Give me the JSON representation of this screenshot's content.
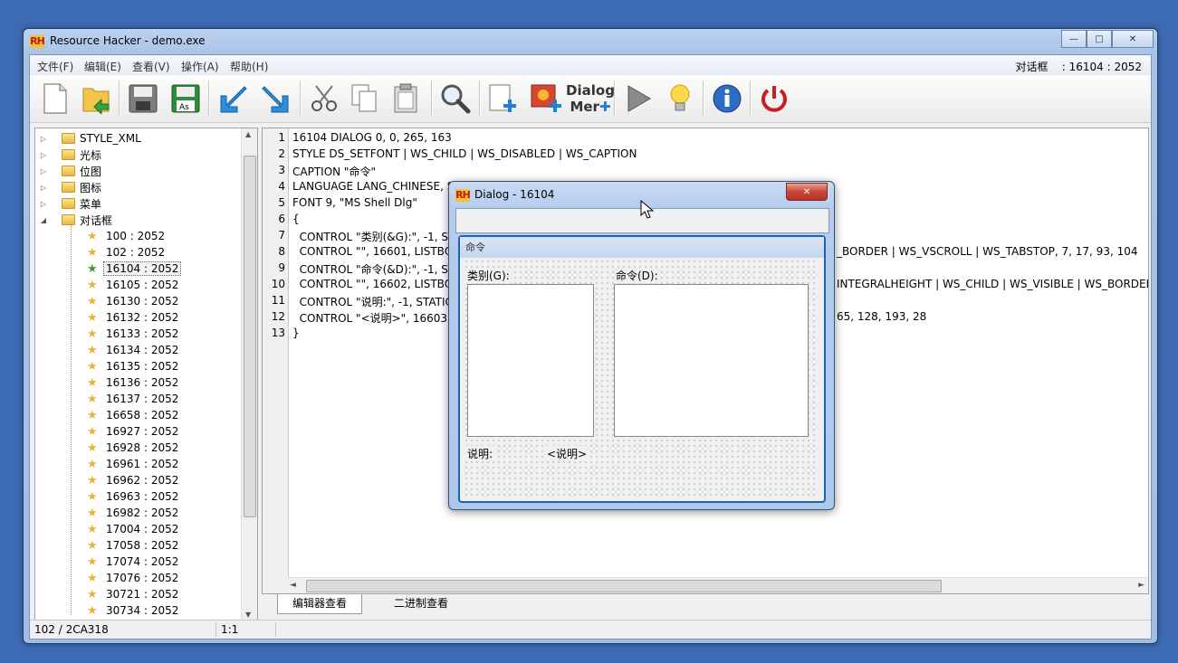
{
  "window": {
    "title": "Resource Hacker - demo.exe",
    "logo_text": "RH",
    "minimize": "—",
    "maximize": "□",
    "close": "✕"
  },
  "menu": {
    "items": [
      "文件(F)",
      "编辑(E)",
      "查看(V)",
      "操作(A)",
      "帮助(H)"
    ],
    "right_status": "对话框    : 16104 : 2052"
  },
  "toolbar": {
    "dialog_merge_label_1": "Dialog",
    "dialog_merge_label_2": "Mer"
  },
  "tree": {
    "folders": [
      "STYLE_XML",
      "光标",
      "位图",
      "图标",
      "菜单",
      "对话框"
    ],
    "items": [
      "100 : 2052",
      "102 : 2052",
      "16104 : 2052",
      "16105 : 2052",
      "16130 : 2052",
      "16132 : 2052",
      "16133 : 2052",
      "16134 : 2052",
      "16135 : 2052",
      "16136 : 2052",
      "16137 : 2052",
      "16658 : 2052",
      "16927 : 2052",
      "16928 : 2052",
      "16961 : 2052",
      "16962 : 2052",
      "16963 : 2052",
      "16982 : 2052",
      "17004 : 2052",
      "17058 : 2052",
      "17074 : 2052",
      "17076 : 2052",
      "30721 : 2052",
      "30734 : 2052"
    ],
    "selected": "16104 : 2052"
  },
  "editor": {
    "line_numbers": [
      "1",
      "2",
      "3",
      "4",
      "5",
      "6",
      "7",
      "8",
      "9",
      "10",
      "11",
      "12",
      "13"
    ],
    "lines": [
      "16104 DIALOG 0, 0, 265, 163",
      "STYLE DS_SETFONT | WS_CHILD | WS_DISABLED | WS_CAPTION",
      "CAPTION \"命令\"",
      "LANGUAGE LANG_CHINESE, SUBLANG_CHINESE_SIMPLIFIED",
      "FONT 9, \"MS Shell Dlg\"",
      "{",
      "  CONTROL \"类别(&G):\", -1, ST",
      "  CONTROL \"\", 16601, LISTBOX",
      "  CONTROL \"命令(&D):\", -1, ST",
      "  CONTROL \"\", 16602, LISTBOX",
      "  CONTROL \"说明:\", -1, STATIC",
      "  CONTROL \"<说明>\", 16603,",
      "}"
    ],
    "line_tails": {
      "8": "_BORDER | WS_VSCROLL | WS_TABSTOP, 7, 17, 93, 104",
      "10": "INTEGRALHEIGHT | WS_CHILD | WS_VISIBLE | WS_BORDER |",
      "12": "65, 128, 193, 28"
    }
  },
  "tabs": [
    "编辑器查看",
    "二进制查看"
  ],
  "statusbar": {
    "position": "102 / 2CA318",
    "cursor": "1:1"
  },
  "dialog_preview": {
    "title": "Dialog - 16104",
    "caption": "命令",
    "label_category": "类别(G):",
    "label_command": "命令(D):",
    "label_desc": "说明:",
    "label_desc_value": "<说明>"
  }
}
